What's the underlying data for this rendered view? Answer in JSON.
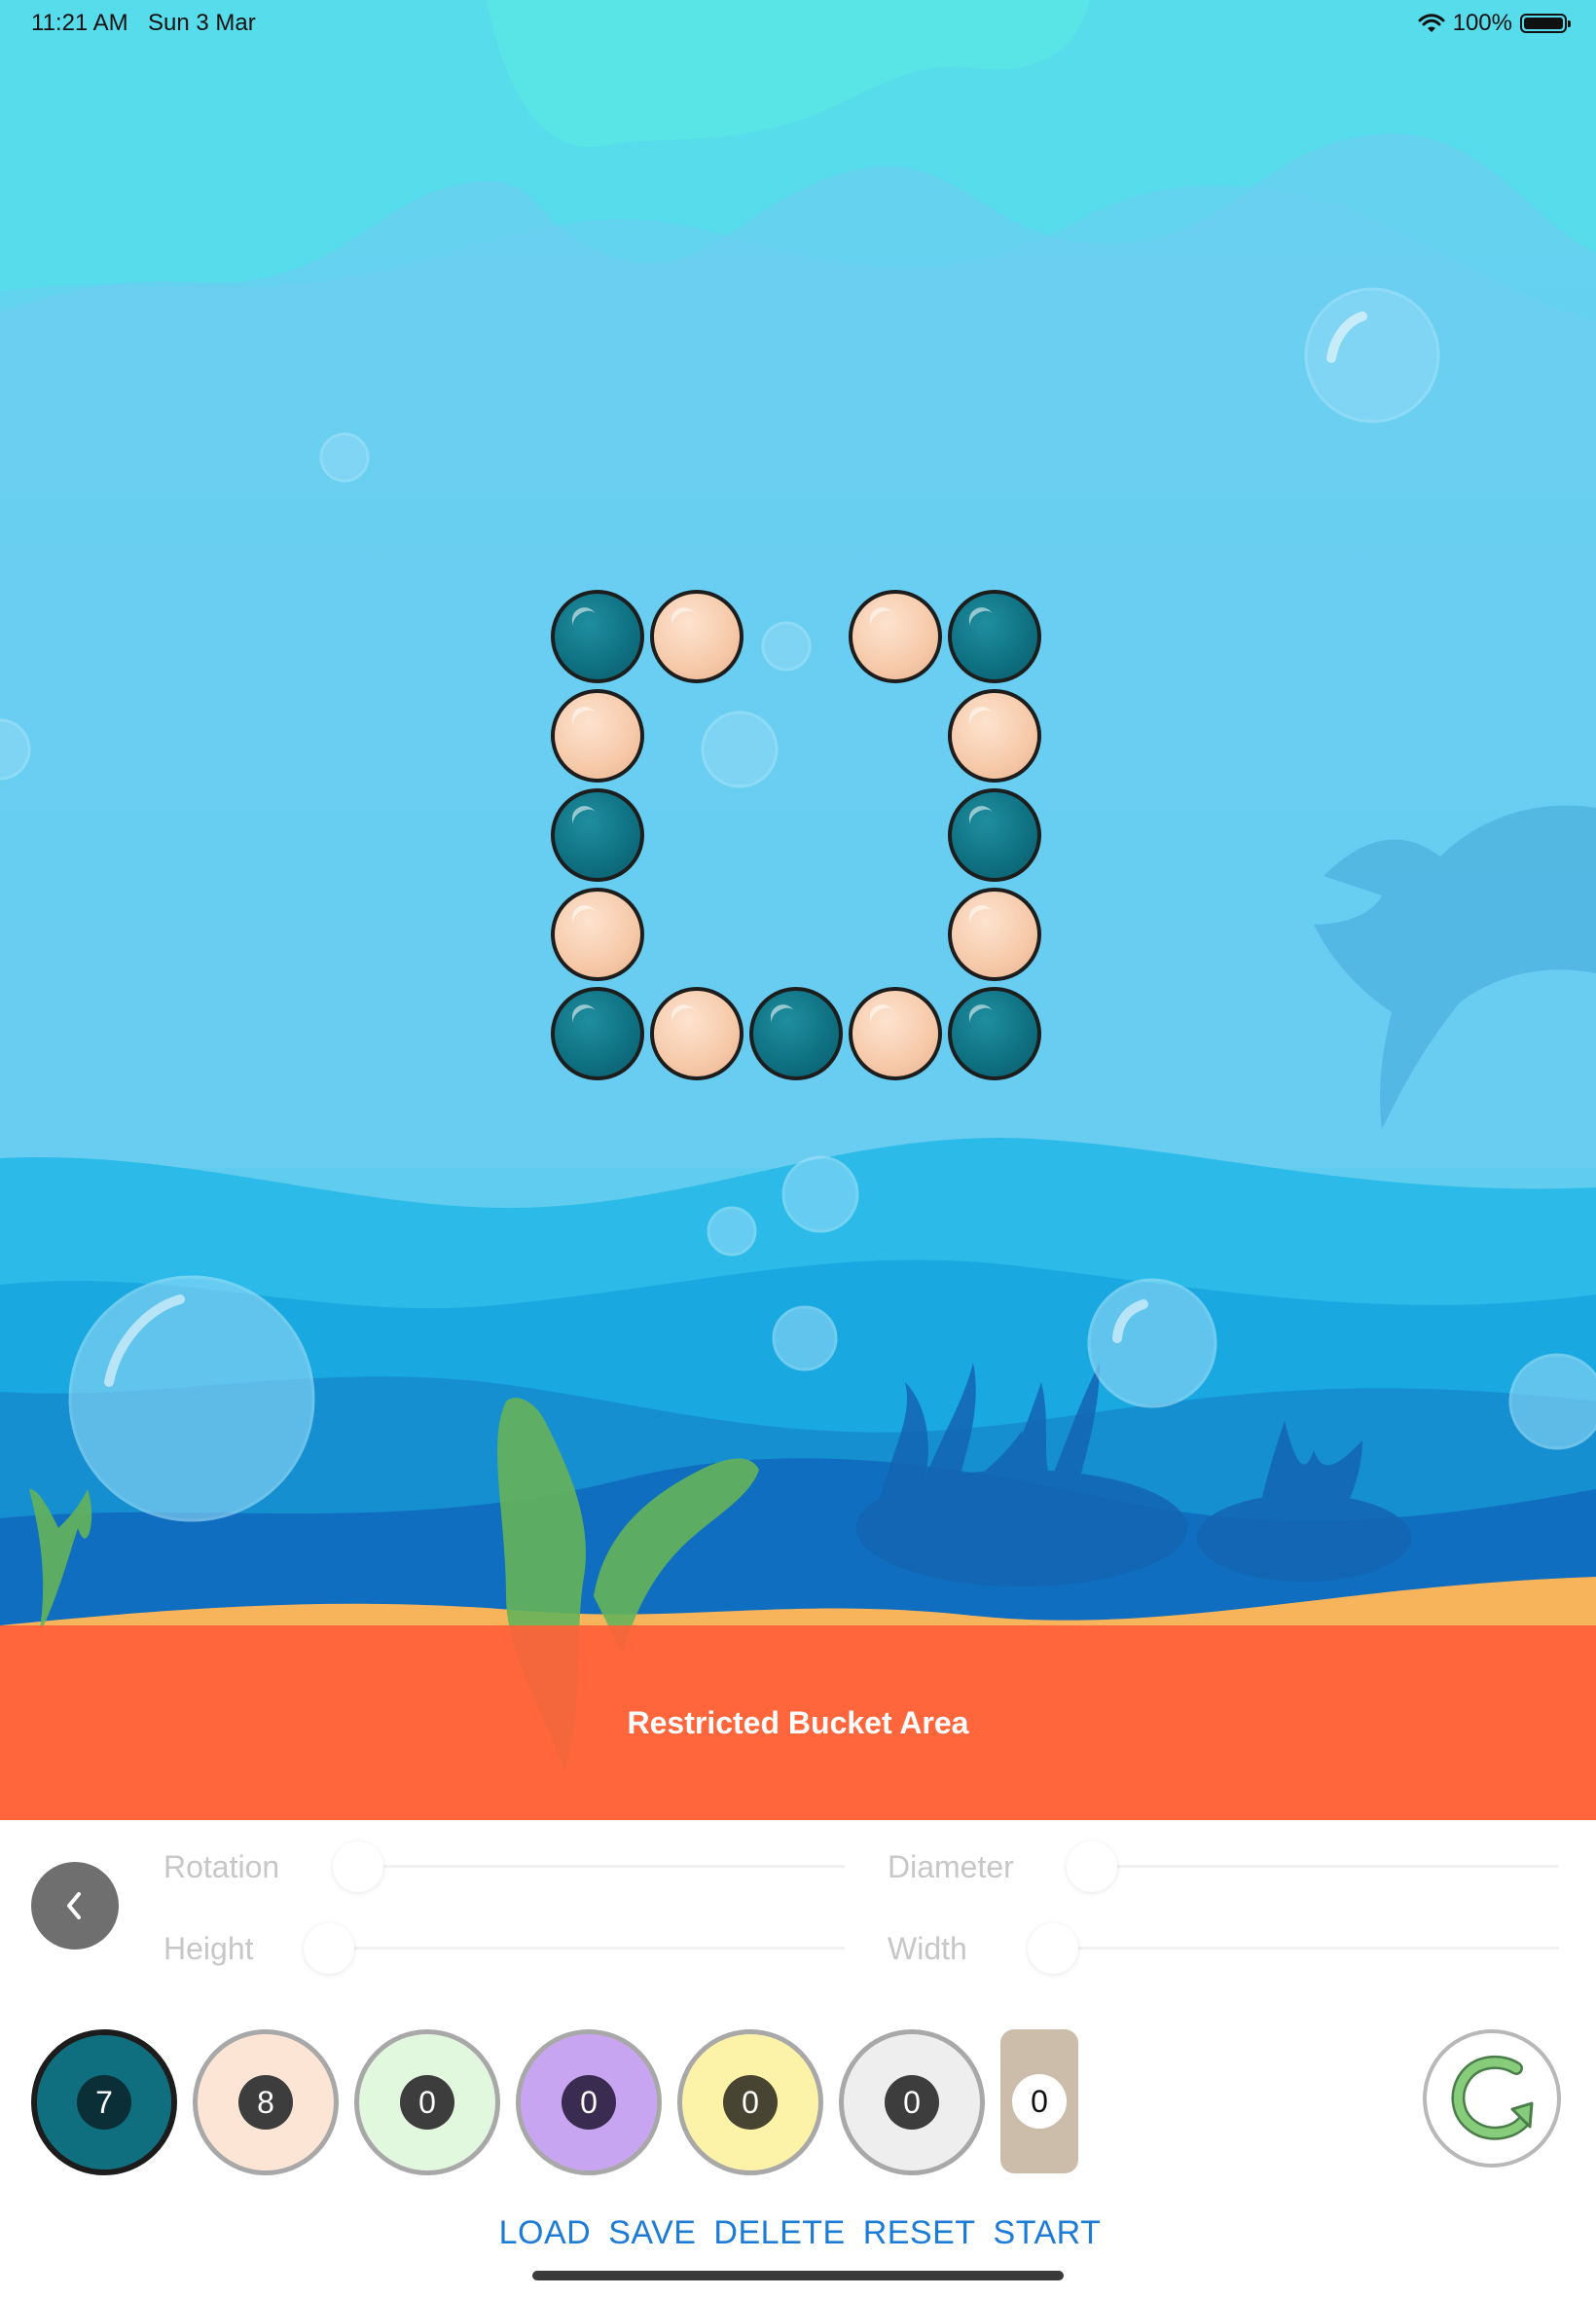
{
  "status_bar": {
    "time": "11:21 AM",
    "date": "Sun 3 Mar",
    "battery": "100%"
  },
  "board": {
    "restricted_label": "Restricted Bucket Area",
    "pegs": [
      {
        "color": "teal"
      },
      {
        "color": "peach"
      },
      {
        "color": "peach"
      },
      {
        "color": "teal"
      },
      {
        "color": "peach"
      },
      {
        "color": "peach"
      },
      {
        "color": "teal"
      },
      {
        "color": "teal"
      },
      {
        "color": "peach"
      },
      {
        "color": "peach"
      },
      {
        "color": "teal"
      },
      {
        "color": "peach"
      },
      {
        "color": "teal"
      },
      {
        "color": "peach"
      },
      {
        "color": "teal"
      }
    ]
  },
  "controls": {
    "rotation_label": "Rotation",
    "diameter_label": "Diameter",
    "height_label": "Height",
    "width_label": "Width",
    "palette": [
      {
        "name": "teal",
        "count": "7",
        "fill": "#0f6f7f",
        "ring": "#1c1c1c",
        "badge": "#0b2f37",
        "selected": true
      },
      {
        "name": "peach",
        "count": "8",
        "fill": "#fde5d5",
        "ring": "#a8a8a8",
        "badge": "#3d3d3d"
      },
      {
        "name": "green",
        "count": "0",
        "fill": "#e1f7de",
        "ring": "#a8a8a8",
        "badge": "#3d3d3d"
      },
      {
        "name": "purple",
        "count": "0",
        "fill": "#c8a5f0",
        "ring": "#a8a8a8",
        "badge": "#3a2b50"
      },
      {
        "name": "yellow",
        "count": "0",
        "fill": "#fdf3a8",
        "ring": "#a8a8a8",
        "badge": "#474532"
      },
      {
        "name": "white",
        "count": "0",
        "fill": "#eeeeee",
        "ring": "#a8a8a8",
        "badge": "#3d3d3d"
      }
    ],
    "rect_block_count": "0",
    "actions": {
      "load": "LOAD",
      "save": "SAVE",
      "delete": "DELETE",
      "reset": "RESET",
      "start": "START"
    }
  },
  "colors": {
    "accent": "#1d7bd8",
    "restricted": "#ff603a",
    "teal": "#0f7283",
    "peach": "#f6c9a9"
  }
}
